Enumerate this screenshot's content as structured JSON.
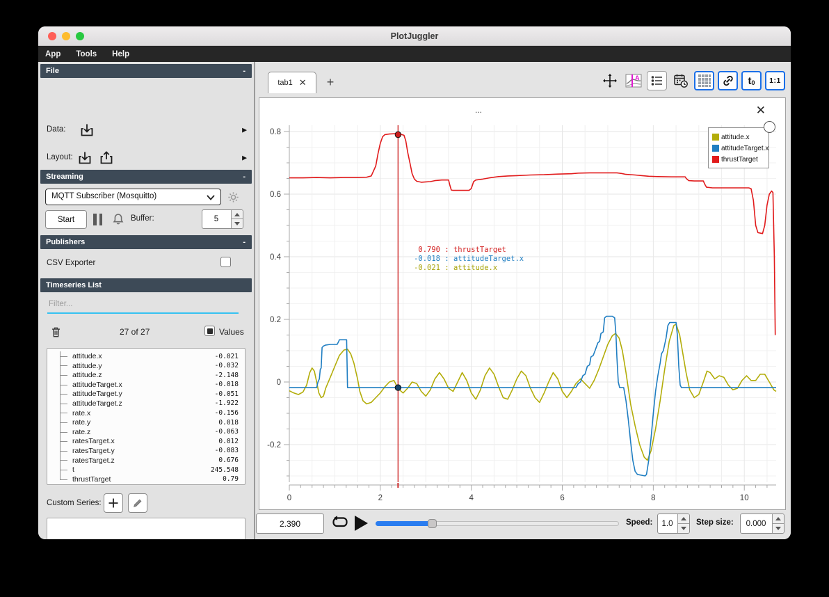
{
  "window": {
    "title": "PlotJuggler"
  },
  "menu": {
    "items": [
      "App",
      "Tools",
      "Help"
    ]
  },
  "icons": {
    "collapse": "-",
    "close": "✕",
    "plus": "+",
    "arrow_right": "▶"
  },
  "sidebar": {
    "file_section": {
      "title": "File",
      "data_label": "Data:",
      "layout_label": "Layout:"
    },
    "streaming_section": {
      "title": "Streaming",
      "source_selected": "MQTT Subscriber (Mosquitto)",
      "start_label": "Start",
      "buffer_label": "Buffer:",
      "buffer_value": "5"
    },
    "publishers_section": {
      "title": "Publishers",
      "csv_label": "CSV Exporter",
      "csv_checked": false
    },
    "timeseries_section": {
      "title": "Timeseries List",
      "filter_placeholder": "Filter...",
      "count_text": "27 of 27",
      "values_label": "Values",
      "values_checked": true,
      "items": [
        {
          "name": "attitude.x",
          "value": "-0.021"
        },
        {
          "name": "attitude.y",
          "value": "-0.032"
        },
        {
          "name": "attitude.z",
          "value": "-2.148"
        },
        {
          "name": "attitudeTarget.x",
          "value": "-0.018"
        },
        {
          "name": "attitudeTarget.y",
          "value": "-0.051"
        },
        {
          "name": "attitudeTarget.z",
          "value": "-1.922"
        },
        {
          "name": "rate.x",
          "value": "-0.156"
        },
        {
          "name": "rate.y",
          "value": "0.018"
        },
        {
          "name": "rate.z",
          "value": "-0.063"
        },
        {
          "name": "ratesTarget.x",
          "value": "0.012"
        },
        {
          "name": "ratesTarget.y",
          "value": "-0.083"
        },
        {
          "name": "ratesTarget.z",
          "value": "0.676"
        },
        {
          "name": "t",
          "value": "245.548"
        },
        {
          "name": "thrustTarget",
          "value": "0.79"
        }
      ]
    },
    "custom_series": {
      "label": "Custom Series:"
    }
  },
  "tabbar": {
    "tabs": [
      {
        "label": "tab1"
      }
    ],
    "add_label": "+"
  },
  "toolbar": {
    "t0_main": "t",
    "t0_sub": "0",
    "ratio_label": "1:1",
    "accent": "#1a6fe8"
  },
  "plot": {
    "title": "...",
    "legend": [
      {
        "label": "attitude.x",
        "color": "#b3ad0a"
      },
      {
        "label": "attitudeTarget.x",
        "color": "#1f7ec2"
      },
      {
        "label": "thrustTarget",
        "color": "#e11b1c"
      }
    ],
    "readouts": [
      {
        "value": "0.790",
        "name": "thrustTarget",
        "color": "#d32222"
      },
      {
        "value": "-0.018",
        "name": "attitudeTarget.x",
        "color": "#1f7ec2"
      },
      {
        "value": "-0.021",
        "name": "attitude.x",
        "color": "#a8a40a"
      }
    ]
  },
  "chart_data": {
    "type": "line",
    "title": "...",
    "xlabel": "",
    "ylabel": "",
    "x_range": [
      0,
      10.7
    ],
    "y_range": [
      -0.32,
      0.82
    ],
    "x_ticks": [
      0,
      2,
      4,
      6,
      8,
      10
    ],
    "y_ticks": [
      -0.2,
      0,
      0.2,
      0.4,
      0.6,
      0.8
    ],
    "x_minor_step": 0.25,
    "y_minor_step": 0.05,
    "grid": true,
    "legend_position": "top-right",
    "tracker": {
      "x": 2.39,
      "color": "#cf2b2b",
      "markers": [
        {
          "y": 0.79,
          "color": "#cf1d1d"
        },
        {
          "y": -0.018,
          "color": "#15456b"
        }
      ]
    },
    "series": [
      {
        "name": "attitude.x",
        "color": "#b3ad0a",
        "points": [
          [
            0,
            -0.028
          ],
          [
            0.1,
            -0.035
          ],
          [
            0.2,
            -0.04
          ],
          [
            0.3,
            -0.032
          ],
          [
            0.38,
            -0.01
          ],
          [
            0.45,
            0.03
          ],
          [
            0.5,
            0.045
          ],
          [
            0.55,
            0.035
          ],
          [
            0.6,
            0
          ],
          [
            0.65,
            -0.035
          ],
          [
            0.7,
            -0.05
          ],
          [
            0.75,
            -0.045
          ],
          [
            0.8,
            -0.02
          ],
          [
            0.9,
            0.015
          ],
          [
            1,
            0.05
          ],
          [
            1.1,
            0.085
          ],
          [
            1.2,
            0.102
          ],
          [
            1.28,
            0.105
          ],
          [
            1.35,
            0.09
          ],
          [
            1.42,
            0.06
          ],
          [
            1.5,
            0.01
          ],
          [
            1.55,
            -0.03
          ],
          [
            1.62,
            -0.06
          ],
          [
            1.7,
            -0.07
          ],
          [
            1.8,
            -0.065
          ],
          [
            1.9,
            -0.05
          ],
          [
            2,
            -0.035
          ],
          [
            2.1,
            -0.015
          ],
          [
            2.2,
            0
          ],
          [
            2.3,
            0.005
          ],
          [
            2.39,
            -0.021
          ],
          [
            2.5,
            -0.035
          ],
          [
            2.6,
            -0.02
          ],
          [
            2.7,
            0
          ],
          [
            2.8,
            -0.005
          ],
          [
            2.9,
            -0.03
          ],
          [
            3,
            -0.045
          ],
          [
            3.1,
            -0.025
          ],
          [
            3.2,
            0.01
          ],
          [
            3.3,
            0.03
          ],
          [
            3.4,
            0.01
          ],
          [
            3.5,
            -0.02
          ],
          [
            3.6,
            -0.03
          ],
          [
            3.7,
            0
          ],
          [
            3.8,
            0.03
          ],
          [
            3.9,
            0.005
          ],
          [
            4,
            -0.035
          ],
          [
            4.1,
            -0.055
          ],
          [
            4.2,
            -0.025
          ],
          [
            4.3,
            0.02
          ],
          [
            4.4,
            0.045
          ],
          [
            4.5,
            0.025
          ],
          [
            4.6,
            -0.015
          ],
          [
            4.7,
            -0.05
          ],
          [
            4.8,
            -0.055
          ],
          [
            4.9,
            -0.025
          ],
          [
            5,
            0.01
          ],
          [
            5.1,
            0.035
          ],
          [
            5.2,
            0.02
          ],
          [
            5.3,
            -0.02
          ],
          [
            5.4,
            -0.05
          ],
          [
            5.5,
            -0.065
          ],
          [
            5.6,
            -0.035
          ],
          [
            5.7,
            0
          ],
          [
            5.8,
            0.03
          ],
          [
            5.9,
            0.01
          ],
          [
            6,
            -0.03
          ],
          [
            6.1,
            -0.05
          ],
          [
            6.2,
            -0.03
          ],
          [
            6.3,
            -0.005
          ],
          [
            6.4,
            0.01
          ],
          [
            6.5,
            -0.005
          ],
          [
            6.6,
            -0.02
          ],
          [
            6.7,
            0.005
          ],
          [
            6.8,
            0.04
          ],
          [
            6.9,
            0.08
          ],
          [
            7,
            0.12
          ],
          [
            7.1,
            0.148
          ],
          [
            7.17,
            0.155
          ],
          [
            7.25,
            0.14
          ],
          [
            7.32,
            0.1
          ],
          [
            7.4,
            0.03
          ],
          [
            7.5,
            -0.07
          ],
          [
            7.6,
            -0.14
          ],
          [
            7.7,
            -0.2
          ],
          [
            7.8,
            -0.24
          ],
          [
            7.87,
            -0.25
          ],
          [
            7.95,
            -0.22
          ],
          [
            8.05,
            -0.15
          ],
          [
            8.15,
            -0.06
          ],
          [
            8.25,
            0.04
          ],
          [
            8.35,
            0.13
          ],
          [
            8.45,
            0.18
          ],
          [
            8.5,
            0.185
          ],
          [
            8.58,
            0.15
          ],
          [
            8.65,
            0.09
          ],
          [
            8.72,
            0.03
          ],
          [
            8.8,
            -0.025
          ],
          [
            8.9,
            -0.05
          ],
          [
            9,
            -0.04
          ],
          [
            9.1,
            0
          ],
          [
            9.18,
            0.035
          ],
          [
            9.25,
            0.03
          ],
          [
            9.35,
            0.01
          ],
          [
            9.45,
            0.02
          ],
          [
            9.55,
            0.015
          ],
          [
            9.65,
            -0.01
          ],
          [
            9.75,
            -0.025
          ],
          [
            9.85,
            -0.02
          ],
          [
            9.95,
            0.005
          ],
          [
            10.05,
            0.02
          ],
          [
            10.15,
            0.005
          ],
          [
            10.25,
            0.005
          ],
          [
            10.35,
            0.025
          ],
          [
            10.45,
            0.025
          ],
          [
            10.55,
            0
          ],
          [
            10.65,
            -0.025
          ],
          [
            10.7,
            -0.03
          ]
        ]
      },
      {
        "name": "attitudeTarget.x",
        "color": "#1f7ec2",
        "points": [
          [
            0,
            -0.018
          ],
          [
            0.6,
            -0.018
          ],
          [
            0.63,
            0
          ],
          [
            0.66,
            0.01
          ],
          [
            0.68,
            0.04
          ],
          [
            0.7,
            0.045
          ],
          [
            0.72,
            0.11
          ],
          [
            0.75,
            0.115
          ],
          [
            0.8,
            0.118
          ],
          [
            0.9,
            0.12
          ],
          [
            1.05,
            0.12
          ],
          [
            1.08,
            0.128
          ],
          [
            1.1,
            0.135
          ],
          [
            1.26,
            0.135
          ],
          [
            1.28,
            -0.018
          ],
          [
            2,
            -0.018
          ],
          [
            4,
            -0.018
          ],
          [
            6.3,
            -0.018
          ],
          [
            6.35,
            -0.005
          ],
          [
            6.4,
            0
          ],
          [
            6.45,
            0.02
          ],
          [
            6.5,
            0.025
          ],
          [
            6.55,
            0.05
          ],
          [
            6.6,
            0.055
          ],
          [
            6.63,
            0.08
          ],
          [
            6.68,
            0.085
          ],
          [
            6.72,
            0.1
          ],
          [
            6.78,
            0.125
          ],
          [
            6.82,
            0.13
          ],
          [
            6.85,
            0.155
          ],
          [
            6.9,
            0.16
          ],
          [
            6.93,
            0.205
          ],
          [
            6.97,
            0.21
          ],
          [
            7.1,
            0.21
          ],
          [
            7.15,
            0.205
          ],
          [
            7.18,
            0.15
          ],
          [
            7.2,
            0.08
          ],
          [
            7.23,
            0
          ],
          [
            7.26,
            -0.018
          ],
          [
            7.35,
            -0.018
          ],
          [
            7.4,
            -0.06
          ],
          [
            7.45,
            -0.12
          ],
          [
            7.5,
            -0.19
          ],
          [
            7.55,
            -0.25
          ],
          [
            7.6,
            -0.285
          ],
          [
            7.65,
            -0.295
          ],
          [
            7.75,
            -0.298
          ],
          [
            7.82,
            -0.3
          ],
          [
            7.85,
            -0.295
          ],
          [
            7.9,
            -0.25
          ],
          [
            7.95,
            -0.18
          ],
          [
            8,
            -0.1
          ],
          [
            8.05,
            -0.03
          ],
          [
            8.1,
            0.02
          ],
          [
            8.15,
            0.06
          ],
          [
            8.18,
            0.09
          ],
          [
            8.22,
            0.1
          ],
          [
            8.28,
            0.14
          ],
          [
            8.32,
            0.18
          ],
          [
            8.36,
            0.19
          ],
          [
            8.5,
            0.19
          ],
          [
            8.53,
            0.15
          ],
          [
            8.56,
            0.05
          ],
          [
            8.59,
            -0.01
          ],
          [
            8.62,
            -0.018
          ],
          [
            9,
            -0.018
          ],
          [
            10,
            -0.018
          ],
          [
            10.7,
            -0.018
          ]
        ]
      },
      {
        "name": "thrustTarget",
        "color": "#e11b1c",
        "points": [
          [
            0,
            0.652
          ],
          [
            0.3,
            0.652
          ],
          [
            0.6,
            0.653
          ],
          [
            0.9,
            0.652
          ],
          [
            1.2,
            0.653
          ],
          [
            1.5,
            0.653
          ],
          [
            1.7,
            0.654
          ],
          [
            1.8,
            0.658
          ],
          [
            1.9,
            0.69
          ],
          [
            1.95,
            0.73
          ],
          [
            2,
            0.762
          ],
          [
            2.05,
            0.783
          ],
          [
            2.1,
            0.79
          ],
          [
            2.2,
            0.792
          ],
          [
            2.35,
            0.793
          ],
          [
            2.45,
            0.791
          ],
          [
            2.52,
            0.788
          ],
          [
            2.56,
            0.77
          ],
          [
            2.6,
            0.735
          ],
          [
            2.65,
            0.7
          ],
          [
            2.7,
            0.665
          ],
          [
            2.75,
            0.648
          ],
          [
            2.8,
            0.641
          ],
          [
            2.9,
            0.638
          ],
          [
            3,
            0.639
          ],
          [
            3.1,
            0.64
          ],
          [
            3.2,
            0.643
          ],
          [
            3.35,
            0.645
          ],
          [
            3.5,
            0.645
          ],
          [
            3.53,
            0.628
          ],
          [
            3.56,
            0.613
          ],
          [
            3.6,
            0.612
          ],
          [
            3.95,
            0.612
          ],
          [
            4,
            0.618
          ],
          [
            4.05,
            0.64
          ],
          [
            4.1,
            0.645
          ],
          [
            4.25,
            0.648
          ],
          [
            4.4,
            0.652
          ],
          [
            4.6,
            0.656
          ],
          [
            4.8,
            0.658
          ],
          [
            5,
            0.659
          ],
          [
            5.3,
            0.661
          ],
          [
            5.6,
            0.662
          ],
          [
            5.9,
            0.664
          ],
          [
            6.2,
            0.665
          ],
          [
            6.35,
            0.667
          ],
          [
            6.6,
            0.668
          ],
          [
            7.2,
            0.668
          ],
          [
            7.3,
            0.666
          ],
          [
            7.4,
            0.663
          ],
          [
            7.6,
            0.661
          ],
          [
            7.75,
            0.659
          ],
          [
            7.9,
            0.657
          ],
          [
            8.1,
            0.656
          ],
          [
            8.4,
            0.655
          ],
          [
            8.7,
            0.655
          ],
          [
            8.73,
            0.649
          ],
          [
            8.78,
            0.643
          ],
          [
            8.9,
            0.642
          ],
          [
            9.1,
            0.642
          ],
          [
            9.13,
            0.632
          ],
          [
            9.17,
            0.622
          ],
          [
            9.3,
            0.62
          ],
          [
            9.9,
            0.62
          ],
          [
            10.1,
            0.62
          ],
          [
            10.15,
            0.617
          ],
          [
            10.2,
            0.58
          ],
          [
            10.25,
            0.5
          ],
          [
            10.3,
            0.477
          ],
          [
            10.4,
            0.474
          ],
          [
            10.45,
            0.5
          ],
          [
            10.5,
            0.565
          ],
          [
            10.55,
            0.6
          ],
          [
            10.6,
            0.61
          ],
          [
            10.63,
            0.605
          ],
          [
            10.66,
            0.4
          ],
          [
            10.68,
            0.15
          ]
        ]
      }
    ]
  },
  "playback": {
    "time_value": "2.390",
    "slider_fraction": 0.23,
    "speed_label": "Speed:",
    "speed_value": "1.0",
    "step_label": "Step size:",
    "step_value": "0.000"
  }
}
